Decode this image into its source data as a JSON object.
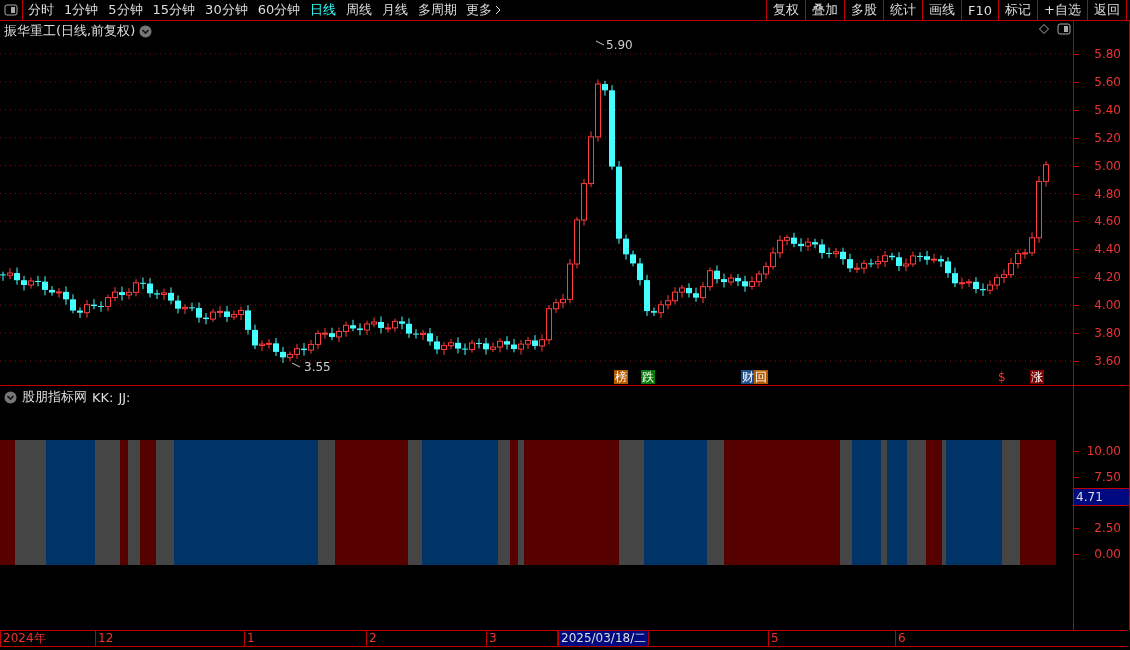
{
  "toolbar": {
    "periods": [
      {
        "label": "分时",
        "selected": false
      },
      {
        "label": "1分钟",
        "selected": false
      },
      {
        "label": "5分钟",
        "selected": false
      },
      {
        "label": "15分钟",
        "selected": false
      },
      {
        "label": "30分钟",
        "selected": false
      },
      {
        "label": "60分钟",
        "selected": false
      },
      {
        "label": "日线",
        "selected": true
      },
      {
        "label": "周线",
        "selected": false
      },
      {
        "label": "月线",
        "selected": false
      },
      {
        "label": "多周期",
        "selected": false
      }
    ],
    "more": "更多",
    "buttons": [
      "复权",
      "叠加",
      "多股",
      "统计",
      "画线",
      "F10",
      "标记",
      "+自选",
      "返回"
    ]
  },
  "price_panel": {
    "title": "振华重工(日线,前复权)",
    "y_axis": [
      "5.80",
      "5.60",
      "5.40",
      "5.20",
      "5.00",
      "4.80",
      "4.60",
      "4.40",
      "4.20",
      "4.00",
      "3.80",
      "3.60"
    ],
    "high_label": "5.90",
    "low_label": "3.55",
    "markers": [
      {
        "text": "榜",
        "kind": "badge",
        "color": "#b35a00"
      },
      {
        "text": "跌",
        "kind": "badge",
        "color": "#0a7a0a"
      },
      {
        "text": "财",
        "kind": "badge",
        "color": "#1c4d8c"
      },
      {
        "text": "回",
        "kind": "badge",
        "color": "#b35a00"
      },
      {
        "text": "$",
        "kind": "text",
        "color": "#ff2a2a"
      },
      {
        "text": "涨",
        "kind": "badge",
        "color": "#7a0000"
      }
    ]
  },
  "indicator_panel": {
    "title": "股朋指标网",
    "series_labels": [
      "KK:",
      "JJ:"
    ],
    "y_axis": [
      "10.00",
      "7.50",
      "2.50",
      "0.00"
    ],
    "current_value": "4.71"
  },
  "date_axis": [
    {
      "label": "2024年",
      "selected": false
    },
    {
      "label": "12",
      "selected": false
    },
    {
      "label": "1",
      "selected": false
    },
    {
      "label": "2",
      "selected": false
    },
    {
      "label": "3",
      "selected": false
    },
    {
      "label": "2025/03/18/二",
      "selected": true
    },
    {
      "label": "5",
      "selected": false
    },
    {
      "label": "6",
      "selected": false
    }
  ]
}
